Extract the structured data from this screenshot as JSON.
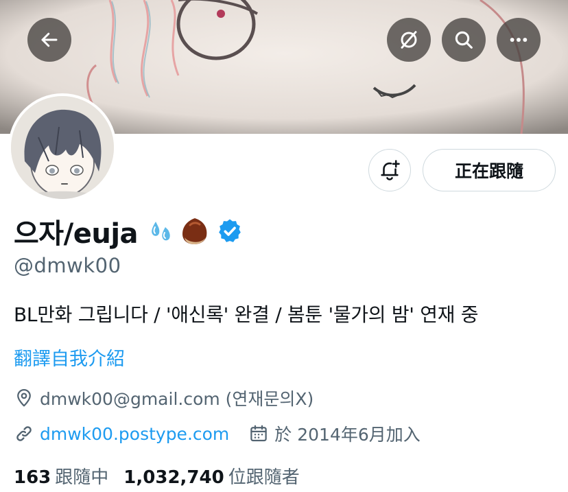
{
  "header": {
    "back_icon": "arrow-left-icon",
    "grok_icon": "slash-circle-icon",
    "search_icon": "search-icon",
    "more_icon": "more-horizontal-icon"
  },
  "profile": {
    "display_name": "으자/euja",
    "emojis": [
      "sweat-droplets-emoji",
      "chestnut-emoji"
    ],
    "verified_icon": "verified-badge-icon",
    "handle": "@dmwk00",
    "bio": "BL만화 그립니다 / '애신록' 완결 / 봄툰 '물가의 밤' 연재 중",
    "translate_label": "翻譯自我介紹",
    "location": "dmwk00@gmail.com (연재문의X)",
    "website": "dmwk00.postype.com",
    "joined": "於 2014年6月加入"
  },
  "actions": {
    "notify_icon": "bell-plus-icon",
    "following_label": "正在跟隨"
  },
  "stats": {
    "following_count": "163",
    "following_label": "跟隨中",
    "followers_count": "1,032,740",
    "followers_label": "位跟隨者"
  },
  "colors": {
    "accent": "#1d9bf0",
    "secondary_text": "#536471",
    "primary_text": "#0f1419",
    "border": "#cfd9de"
  }
}
